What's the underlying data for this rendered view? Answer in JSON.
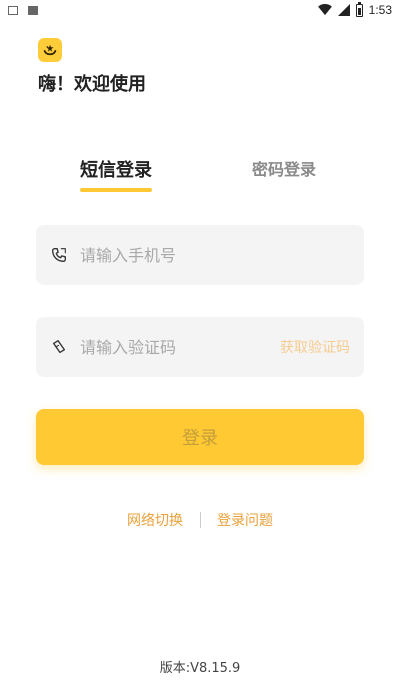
{
  "status_bar": {
    "time": "1:53",
    "left_icons": [
      "keyboard-indicator-icon",
      "app-indicator-icon"
    ],
    "right_icons": [
      "wifi-icon",
      "signal-icon",
      "battery-icon"
    ]
  },
  "header": {
    "logo_icon": "smile-star-icon",
    "greeting": "嗨！欢迎使用"
  },
  "tabs": [
    {
      "label": "短信登录",
      "active": true
    },
    {
      "label": "密码登录",
      "active": false
    }
  ],
  "form": {
    "phone": {
      "icon": "phone-icon",
      "placeholder": "请输入手机号",
      "value": ""
    },
    "code": {
      "icon": "code-icon",
      "placeholder": "请输入验证码",
      "value": "",
      "get_code_label": "获取验证码"
    },
    "login_label": "登录"
  },
  "help": {
    "network_switch": "网络切换",
    "login_issue": "登录问题"
  },
  "version": "版本:V8.15.9",
  "colors": {
    "accent": "#ffc933",
    "accent_text": "#e9a13b",
    "get_code_text": "#f7cc8f",
    "field_bg": "#f4f4f5",
    "inactive_tab": "#8a8a8a",
    "login_text": "#c39f3b"
  }
}
